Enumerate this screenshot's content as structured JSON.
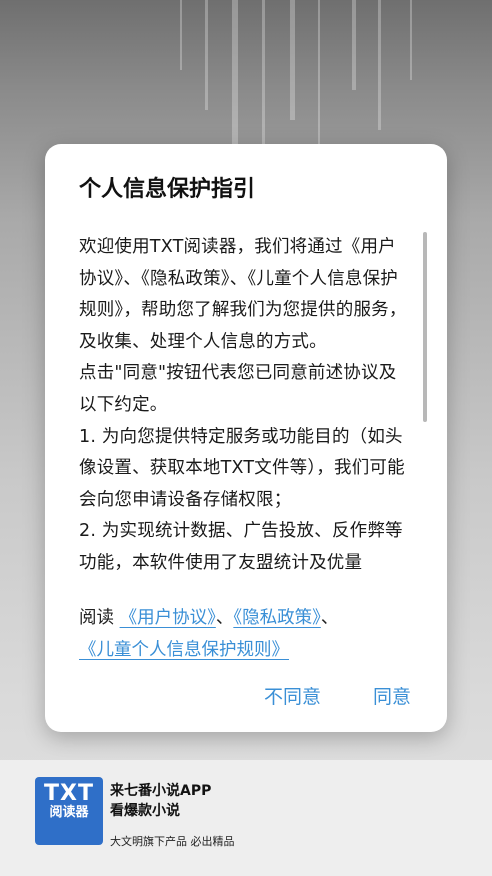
{
  "dialog": {
    "title": "个人信息保护指引",
    "paragraphs": [
      "欢迎使用TXT阅读器，我们将通过《用户协议》、《隐私政策》、《儿童个人信息保护规则》，帮助您了解我们为您提供的服务，及收集、处理个人信息的方式。",
      "点击\"同意\"按钮代表您已同意前述协议及以下约定。",
      "1. 为向您提供特定服务或功能目的（如头像设置、获取本地TXT文件等），我们可能会向您申请设备存储权限；",
      "2. 为实现统计数据、广告投放、反作弊等功能，本软件使用了友盟统计及优量"
    ],
    "read_prefix": "阅读",
    "link_user_agreement": "《用户协议》",
    "sep1": "、",
    "link_privacy_policy": "《隐私政策》",
    "sep2": "、",
    "link_children_rules": "《儿童个人信息保护规则》",
    "disagree_label": "不同意",
    "agree_label": "同意"
  },
  "footer": {
    "logo_main": "TXT",
    "logo_sub": "阅读器",
    "slogan_line1": "来七番小说APP",
    "slogan_line2": "看爆款小说",
    "company": "大文明旗下产品 必出精品"
  },
  "colors": {
    "accent": "#3a8fd6",
    "logo_blue": "#2f6fc8"
  }
}
